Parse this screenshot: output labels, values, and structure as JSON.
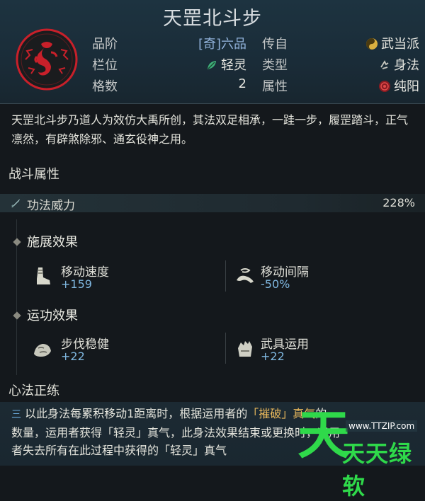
{
  "skill": {
    "title": "天罡北斗步",
    "attributes": {
      "rank_label": "品阶",
      "rank_value": "[奇]六品",
      "slot_label": "栏位",
      "slot_value": "轻灵",
      "grid_label": "格数",
      "grid_value": "2",
      "origin_label": "传自",
      "origin_value": "武当派",
      "type_label": "类型",
      "type_value": "身法",
      "element_label": "属性",
      "element_value": "纯阳"
    },
    "description": "天罡北斗步乃道人为效仿大禹所创，其法双足相承，一跬一步，履罡踏斗，正气凛然，有辟煞除邪、通玄役神之用。"
  },
  "combat": {
    "heading": "战斗属性",
    "power_label": "功法威力",
    "power_value": "228%",
    "cast": {
      "heading": "施展效果",
      "effects": [
        {
          "name": "移动速度",
          "value": "+159",
          "icon": "boot-icon"
        },
        {
          "name": "移动间隔",
          "value": "-50%",
          "icon": "swirl-step-icon"
        }
      ]
    },
    "operate": {
      "heading": "运功效果",
      "effects": [
        {
          "name": "步伐稳健",
          "value": "+22",
          "icon": "stone-foot-icon"
        },
        {
          "name": "武具运用",
          "value": "+22",
          "icon": "gauntlet-icon"
        }
      ]
    }
  },
  "heart": {
    "heading": "心法正练",
    "marker": "三",
    "line1_pre": "以此身法每累积移动1距离时，根据运用者的",
    "line1_hl": "「摧破」真气",
    "line1_post": "的",
    "line2": "数量，运用者获得「轻灵」真气，此身法效果结束或更换时，运用",
    "line3": "者失去所有在此过程中获得的「轻灵」真气"
  },
  "watermark": {
    "big": "天",
    "url": "www.TTZIP.com",
    "text": "天天绿软"
  },
  "colors": {
    "accent_blue": "#7fb7e0",
    "highlight": "#e8b85c",
    "emblem_red": "#c8202a",
    "watermark_green": "#2fd94a"
  }
}
